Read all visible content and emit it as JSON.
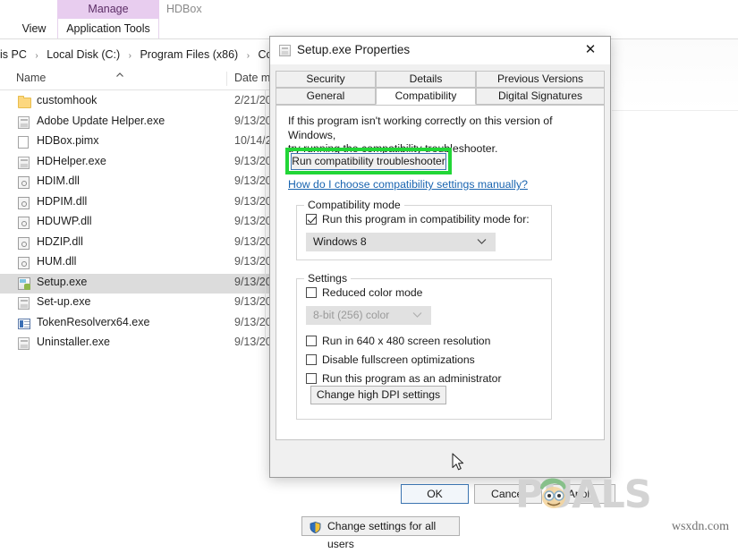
{
  "explorer": {
    "ribbon": {
      "manage_group_top": "Manage",
      "manage_group_bottom": "Application Tools",
      "view_tab": "View",
      "window_title_fragment": "HDBox"
    },
    "breadcrumb": {
      "parts": [
        "is PC",
        "Local Disk (C:)",
        "Program Files (x86)",
        "Commo"
      ],
      "separator": "›"
    },
    "columns": {
      "name": "Name",
      "date": "Date m",
      "sort_caret": "^"
    },
    "files": [
      {
        "name": "customhook",
        "date": "2/21/20",
        "icon": "folder-icon",
        "type": "folder",
        "selected": false
      },
      {
        "name": "Adobe Update Helper.exe",
        "date": "9/13/20",
        "icon": "exe-icon",
        "type": "exe",
        "selected": false
      },
      {
        "name": "HDBox.pimx",
        "date": "10/14/2",
        "icon": "document-icon",
        "type": "document",
        "selected": false
      },
      {
        "name": "HDHelper.exe",
        "date": "9/13/20",
        "icon": "exe-icon",
        "type": "exe",
        "selected": false
      },
      {
        "name": "HDIM.dll",
        "date": "9/13/20",
        "icon": "dll-icon",
        "type": "dll",
        "selected": false
      },
      {
        "name": "HDPIM.dll",
        "date": "9/13/20",
        "icon": "dll-icon",
        "type": "dll",
        "selected": false
      },
      {
        "name": "HDUWP.dll",
        "date": "9/13/20",
        "icon": "dll-icon",
        "type": "dll",
        "selected": false
      },
      {
        "name": "HDZIP.dll",
        "date": "9/13/20",
        "icon": "dll-icon",
        "type": "dll",
        "selected": false
      },
      {
        "name": "HUM.dll",
        "date": "9/13/20",
        "icon": "dll-icon",
        "type": "dll",
        "selected": false
      },
      {
        "name": "Setup.exe",
        "date": "9/13/20",
        "icon": "setup-icon",
        "type": "setup",
        "selected": true
      },
      {
        "name": "Set-up.exe",
        "date": "9/13/20",
        "icon": "exe-icon",
        "type": "exe",
        "selected": false
      },
      {
        "name": "TokenResolverx64.exe",
        "date": "9/13/20",
        "icon": "token-icon",
        "type": "token",
        "selected": false
      },
      {
        "name": "Uninstaller.exe",
        "date": "9/13/20",
        "icon": "exe-icon",
        "type": "exe",
        "selected": false
      }
    ]
  },
  "dialog": {
    "title": "Setup.exe Properties",
    "title_icon": "application-icon",
    "close_icon": "✕",
    "tabs_row1": [
      {
        "label": "Security",
        "active": false
      },
      {
        "label": "Details",
        "active": false
      },
      {
        "label": "Previous Versions",
        "active": false
      }
    ],
    "tabs_row2": [
      {
        "label": "General",
        "active": false
      },
      {
        "label": "Compatibility",
        "active": true
      },
      {
        "label": "Digital Signatures",
        "active": false
      }
    ],
    "compatibility": {
      "intro_line1": "If this program isn't working correctly on this version of Windows,",
      "intro_line2": "try running the compatibility troubleshooter.",
      "troubleshoot_button": "Run compatibility troubleshooter",
      "help_link": "How do I choose compatibility settings manually?",
      "highlight_color": "#22d637",
      "compat_mode_group": {
        "legend": "Compatibility mode",
        "checkbox_label": "Run this program in compatibility mode for:",
        "checkbox_checked": true,
        "selected_os": "Windows 8"
      },
      "settings_group": {
        "legend": "Settings",
        "reduced_color_mode": {
          "label": "Reduced color mode",
          "checked": false
        },
        "color_depth_value": "8-bit (256) color",
        "color_depth_disabled": true,
        "run_640x480": {
          "label": "Run in 640 x 480 screen resolution",
          "checked": false
        },
        "disable_fullscreen": {
          "label": "Disable fullscreen optimizations",
          "checked": false
        },
        "run_as_admin": {
          "label": "Run this program as an administrator",
          "checked": false
        },
        "dpi_button": "Change high DPI settings"
      },
      "all_users_button": "Change settings for all users",
      "all_users_icon": "uac-shield-icon"
    },
    "footer": {
      "ok": "OK",
      "cancel": "Cancel",
      "apply": "Apply"
    }
  },
  "watermark": {
    "brand": "PUALS",
    "site_credit": "wsxdn.com"
  }
}
